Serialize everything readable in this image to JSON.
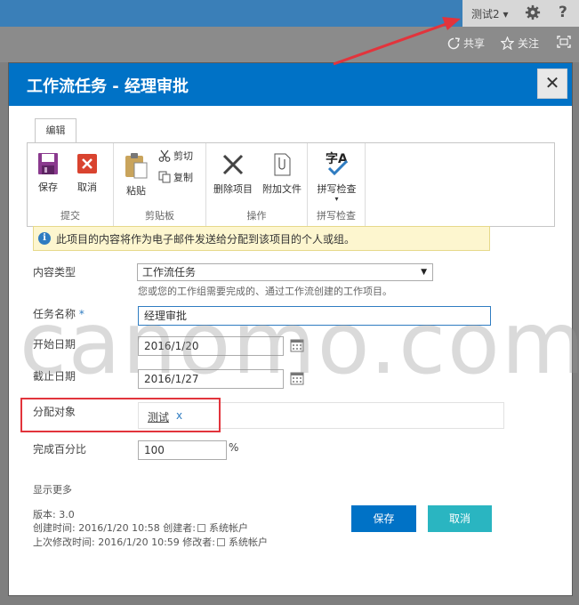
{
  "suite": {
    "user_label": "测试2 ▾",
    "help_label": "?"
  },
  "page": {
    "share_label": "共享",
    "follow_label": "关注"
  },
  "dialog": {
    "title": "工作流任务 - 经理审批",
    "close_label": "✕"
  },
  "ribbon": {
    "tab_label": "编辑",
    "groups": [
      {
        "label": "提交",
        "buttons": [
          "保存",
          "取消"
        ]
      },
      {
        "label": "剪贴板",
        "buttons": [
          "粘贴",
          "剪切",
          "复制"
        ]
      },
      {
        "label": "操作",
        "buttons": [
          "删除项目",
          "附加文件"
        ]
      },
      {
        "label": "拼写检查",
        "buttons": [
          "拼写检查"
        ]
      }
    ]
  },
  "info": {
    "icon": "i",
    "text": "此项目的内容将作为电子邮件发送给分配到该项目的个人或组。"
  },
  "form": {
    "content_type_label": "内容类型",
    "content_type_value": "工作流任务",
    "content_type_hint": "您或您的工作组需要完成的、通过工作流创建的工作项目。",
    "task_name_label": "任务名称",
    "required_mark": "*",
    "task_name_value": "经理审批",
    "start_date_label": "开始日期",
    "start_date_value": "2016/1/20",
    "due_date_label": "截止日期",
    "due_date_value": "2016/1/27",
    "assigned_label": "分配对象",
    "assigned_person": "测试",
    "remove_label": "x",
    "percent_label": "完成百分比",
    "percent_value": "100",
    "percent_sign": "%"
  },
  "footer": {
    "show_more": "显示更多",
    "version": "版本: 3.0",
    "created_prefix": "创建时间: 2016/1/20 10:58  创建者:",
    "created_by": "系统帐户",
    "modified_prefix": "上次修改时间: 2016/1/20 10:59  修改者:",
    "modified_by": "系统帐户",
    "save_label": "保存",
    "cancel_label": "取消"
  },
  "watermark": "canomo.com",
  "colors": {
    "suitebar": "#3a7fb8",
    "dialog_header": "#0072c6",
    "save_button": "#0072c6",
    "cancel_button": "#2ab5c1",
    "highlight_box": "#e2343c",
    "annotation_arrow": "#e2343c"
  }
}
